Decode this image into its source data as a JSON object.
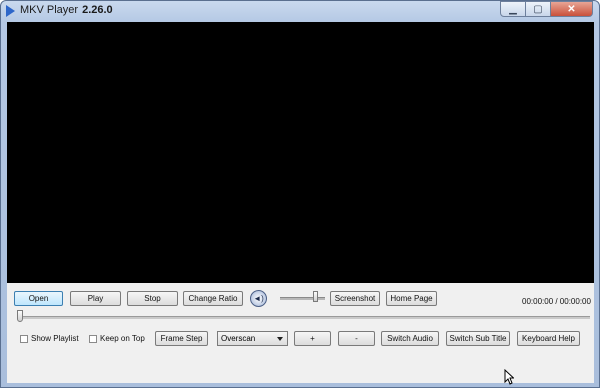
{
  "window": {
    "app_name": "MKV Player",
    "version": "2.26.0",
    "minimize_glyph": "▁",
    "maximize_glyph": "▢",
    "close_glyph": "✕"
  },
  "controls": {
    "open": "Open",
    "play": "Play",
    "stop": "Stop",
    "change_ratio": "Change Ratio",
    "screenshot": "Screenshot",
    "home_page": "Home Page",
    "frame_step": "Frame Step",
    "plus": "+",
    "minus": "-",
    "switch_audio": "Switch Audio",
    "switch_sub_title": "Switch Sub Title",
    "keyboard_help": "Keyboard Help",
    "volume_glyph": "◄)"
  },
  "checkboxes": {
    "show_playlist": "Show Playlist",
    "keep_on_top": "Keep on Top"
  },
  "display_mode": {
    "selected": "Overscan"
  },
  "time_display": "00:00:00 / 00:00:00",
  "playback": {
    "seek_fraction": 0.0,
    "volume_fraction": 0.8
  }
}
